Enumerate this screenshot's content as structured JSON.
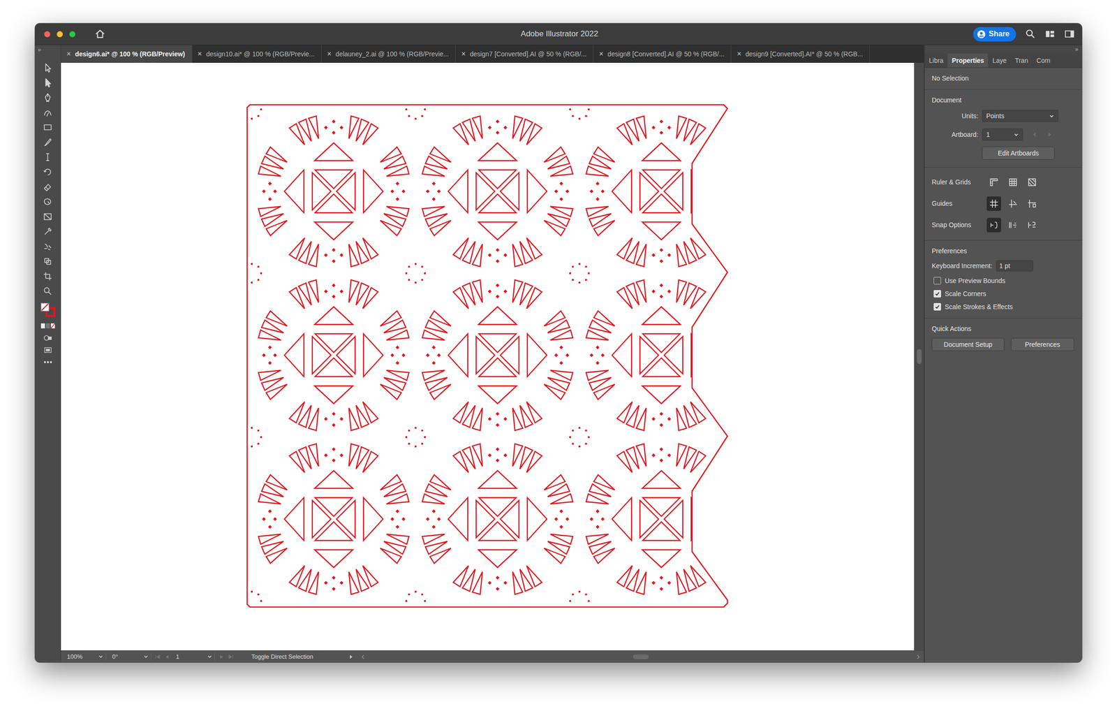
{
  "window": {
    "title": "Adobe Illustrator 2022",
    "traffic_lights": [
      {
        "color": "#fe5f57"
      },
      {
        "color": "#febc2e"
      },
      {
        "color": "#28c840"
      }
    ]
  },
  "titlebar": {
    "share": "Share"
  },
  "grip": "»",
  "close_glyph": "×",
  "document_tabs": [
    {
      "label": "design6.ai* @ 100 % (RGB/Preview)",
      "selected": true
    },
    {
      "label": "design10.ai* @ 100 % (RGB/Previe...",
      "selected": false
    },
    {
      "label": "delauney_2.ai @ 100 % (RGB/Previe...",
      "selected": false
    },
    {
      "label": "design7 [Converted].AI @ 50 % (RGB/...",
      "selected": false
    },
    {
      "label": "design8 [Converted].AI @ 50 % (RGB/...",
      "selected": false
    },
    {
      "label": "design9 [Converted].AI* @ 50 % (RGB...",
      "selected": false
    }
  ],
  "artwork": {
    "motif_rows": 3,
    "motif_columns": 3
  },
  "panel_tabs": [
    {
      "label": "Libra",
      "selected": false
    },
    {
      "label": "Properties",
      "selected": true
    },
    {
      "label": "Laye",
      "selected": false
    },
    {
      "label": "Tran",
      "selected": false
    },
    {
      "label": "Com",
      "selected": false
    }
  ],
  "properties": {
    "selection": "No Selection",
    "document_heading": "Document",
    "fields": [
      {
        "label": "Units:",
        "value": "Points",
        "kind": "dropdown"
      },
      {
        "label": "Artboard:",
        "value": "1",
        "kind": "artboard"
      }
    ],
    "edit_button": "Edit Artboards",
    "toggle_rows": [
      {
        "label": "Ruler & Grids",
        "toggles": [
          {
            "on": false
          },
          {
            "on": false
          },
          {
            "on": false
          }
        ]
      },
      {
        "label": "Guides",
        "toggles": [
          {
            "on": true
          },
          {
            "on": false
          },
          {
            "on": false
          }
        ]
      },
      {
        "label": "Snap Options",
        "toggles": [
          {
            "on": true
          },
          {
            "on": false
          },
          {
            "on": false
          }
        ]
      }
    ],
    "preferences_heading": "Preferences",
    "keyboard_increment": {
      "label": "Keyboard Increment:",
      "value": "1 pt"
    },
    "checkboxes": [
      {
        "label": "Use Preview Bounds",
        "checked": false
      },
      {
        "label": "Scale Corners",
        "checked": true
      },
      {
        "label": "Scale Strokes & Effects",
        "checked": true
      }
    ],
    "quick_actions_heading": "Quick Actions",
    "quick_actions": [
      "Document Setup",
      "Preferences"
    ]
  },
  "status_bar": {
    "zoom": "100%",
    "rotation": "0°",
    "artboard": "1",
    "tool": "Toggle Direct Selection"
  }
}
